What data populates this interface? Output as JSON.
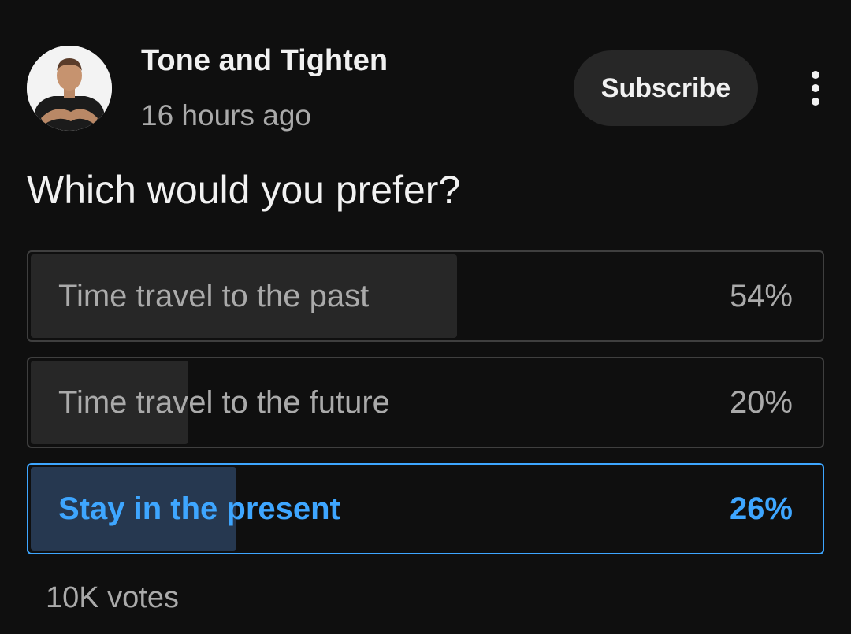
{
  "post": {
    "channel_name": "Tone and Tighten",
    "timestamp": "16 hours ago",
    "subscribe_label": "Subscribe",
    "avatar_icon": "profile-photo",
    "menu_icon": "more-vert-icon",
    "question": "Which would you prefer?"
  },
  "poll": {
    "options": [
      {
        "label": "Time travel to the past",
        "percent_text": "54%",
        "fill_fraction": 0.54,
        "selected": false
      },
      {
        "label": "Time travel to the future",
        "percent_text": "20%",
        "fill_fraction": 0.2,
        "selected": false
      },
      {
        "label": "Stay in the present",
        "percent_text": "26%",
        "fill_fraction": 0.26,
        "selected": true
      }
    ],
    "votes": "10K votes"
  },
  "colors": {
    "background": "#0f0f0f",
    "accent": "#3ea6ff",
    "selected_fill": "#263850",
    "bar_fill": "#272727",
    "outline": "#3f3f3f"
  }
}
